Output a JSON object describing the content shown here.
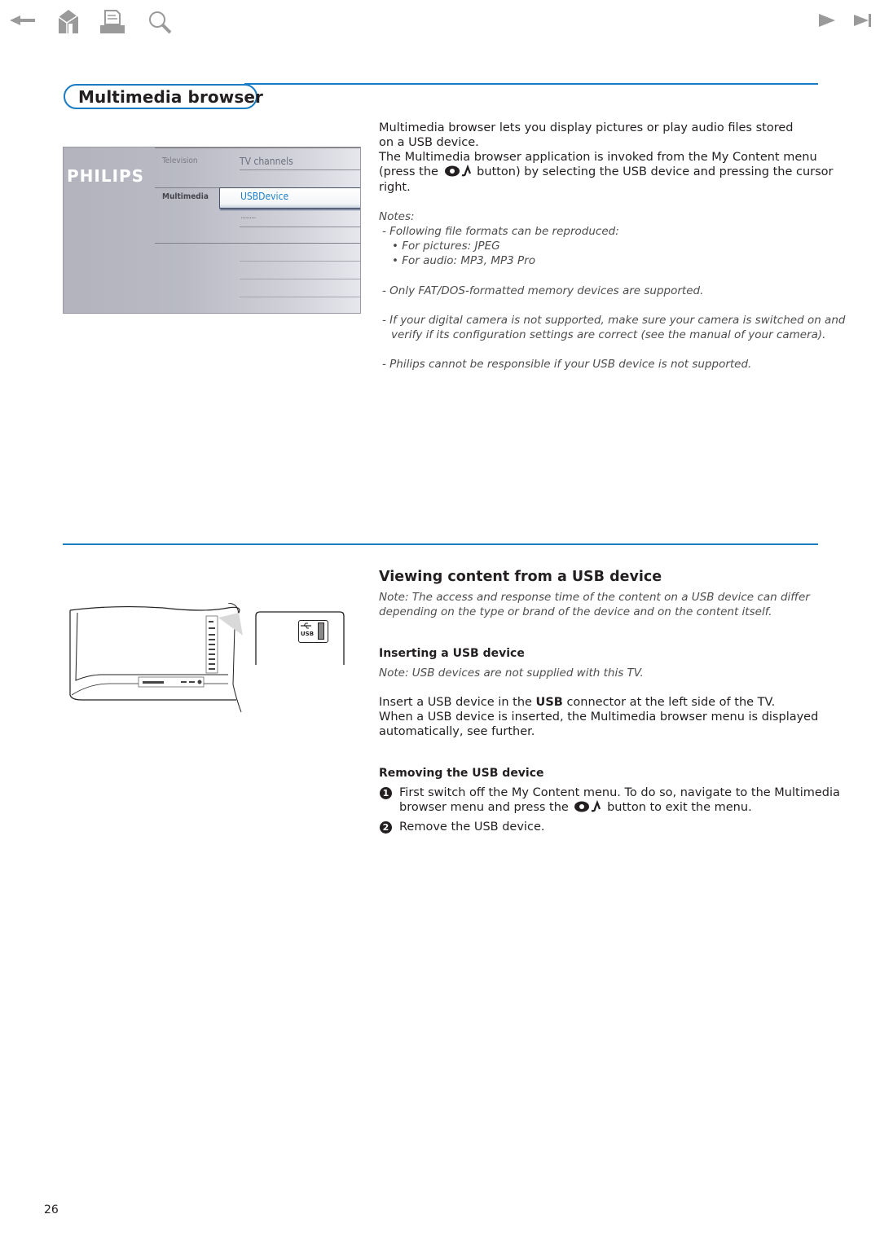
{
  "nav": {
    "back": {
      "icon": "arrow-left-icon",
      "color": "#9a9a9a"
    },
    "home": {
      "icon": "home-icon",
      "color": "#9a9a9a"
    },
    "print": {
      "icon": "printer-icon",
      "color": "#9a9a9a"
    },
    "search": {
      "icon": "magnifier-icon",
      "color": "#9a9a9a"
    },
    "next": {
      "icon": "play-next-icon",
      "color": "#9a9a9a"
    },
    "last": {
      "icon": "skip-end-icon",
      "color": "#9a9a9a"
    }
  },
  "accent_color": "#1a7dc4",
  "section1": {
    "title": "Multimedia browser",
    "tv_menu": {
      "brand": "PHILIPS",
      "col1": [
        "Television",
        "Multimedia"
      ],
      "col2_top": "TV channels",
      "selected_item": "USBDevice",
      "placeholder_item": ".........."
    },
    "intro": [
      "Multimedia browser lets you display pictures or play audio files stored on a USB device.",
      "The Multimedia browser application is invoked from the My Content menu"
    ],
    "intro_press_before": "(press the",
    "intro_press_after": "button) by selecting the USB device and pressing the cursor",
    "intro_end": "right.",
    "notes_title": "Notes:",
    "notes": {
      "formats": "- Following file formats can be reproduced:",
      "pictures": "• For pictures: JPEG",
      "audio": "• For audio: MP3, MP3 Pro",
      "fat": "- Only FAT/DOS-formatted memory devices are supported.",
      "camera_1": "- If your digital camera is not supported, make sure your camera is switched on and",
      "camera_2": "verify if its configuration settings are correct (see the manual of your camera).",
      "philips": "- Philips cannot be responsible if your USB device is not supported."
    }
  },
  "section2": {
    "title": "Viewing content from a USB device",
    "note_1": "Note: The access and response time of the content on a USB device can differ",
    "note_2": "depending on the type or brand of the device and on the content itself.",
    "illustration": {
      "usb_label": "USB"
    },
    "inserting": {
      "title": "Inserting a USB device",
      "note": "Note: USB devices are not supplied with this TV.",
      "line1_before": "Insert a USB device in the",
      "line1_bold": "USB",
      "line1_after": "connector at the left side of the TV.",
      "line2": "When a USB device is inserted, the Multimedia browser menu is displayed",
      "line3": "automatically, see further."
    },
    "removing": {
      "title": "Removing the USB device",
      "steps": [
        {
          "num": "1",
          "line1": "First switch off the My Content menu. To do so, navigate to the Multimedia",
          "line2_before": "browser menu and press the",
          "line2_after": "button to exit the menu."
        },
        {
          "num": "2",
          "line1": "Remove the USB device."
        }
      ]
    }
  },
  "page_number": "26"
}
